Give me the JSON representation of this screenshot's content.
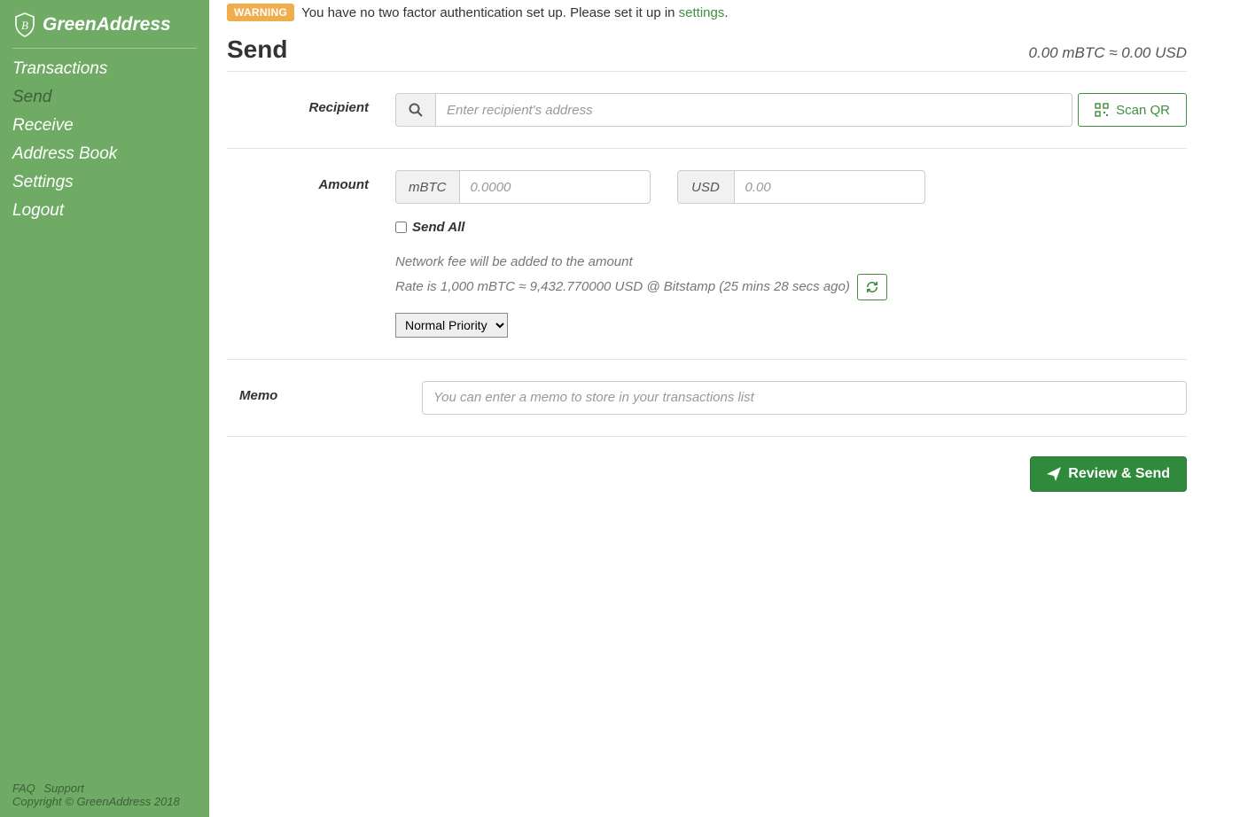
{
  "brand": "GreenAddress",
  "sidebar": {
    "items": [
      {
        "label": "Transactions",
        "active": false
      },
      {
        "label": "Send",
        "active": true
      },
      {
        "label": "Receive",
        "active": false
      },
      {
        "label": "Address Book",
        "active": false
      },
      {
        "label": "Settings",
        "active": false
      },
      {
        "label": "Logout",
        "active": false
      }
    ],
    "footer": {
      "faq": "FAQ",
      "support": "Support",
      "copyright": "Copyright © GreenAddress 2018"
    }
  },
  "warning": {
    "badge": "WARNING",
    "message": "You have no two factor authentication set up. Please set it up in ",
    "link": "settings",
    "tail": "."
  },
  "page": {
    "title": "Send",
    "balance": "0.00 mBTC ≈ 0.00 USD"
  },
  "recipient": {
    "label": "Recipient",
    "placeholder": "Enter recipient's address",
    "scan_label": "Scan QR"
  },
  "amount": {
    "label": "Amount",
    "crypto_unit": "mBTC",
    "crypto_placeholder": "0.0000",
    "fiat_unit": "USD",
    "fiat_placeholder": "0.00",
    "send_all_label": "Send All",
    "fee_note": "Network fee will be added to the amount",
    "rate_note": "Rate is 1,000 mBTC ≈ 9,432.770000 USD @ Bitstamp (25 mins 28 secs ago)",
    "priority_options": [
      "Normal Priority"
    ],
    "priority_selected": "Normal Priority"
  },
  "memo": {
    "label": "Memo",
    "placeholder": "You can enter a memo to store in your transactions list"
  },
  "actions": {
    "review_send": "Review & Send"
  }
}
